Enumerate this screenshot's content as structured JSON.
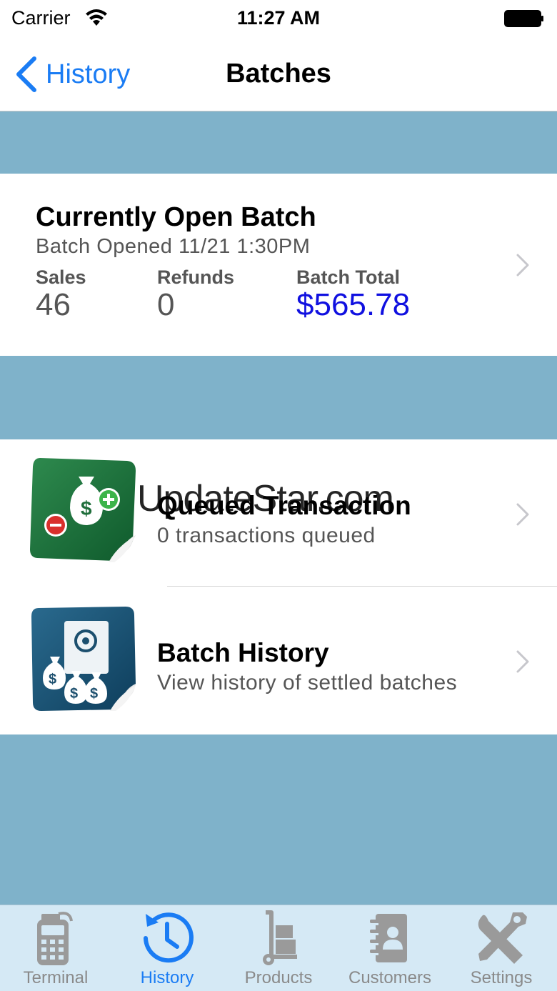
{
  "status_bar": {
    "carrier": "Carrier",
    "time": "11:27 AM"
  },
  "nav": {
    "back_label": "History",
    "title": "Batches"
  },
  "open_batch": {
    "title": "Currently Open Batch",
    "opened": "Batch Opened 11/21 1:30PM",
    "sales_label": "Sales",
    "sales_value": "46",
    "refunds_label": "Refunds",
    "refunds_value": "0",
    "total_label": "Batch Total",
    "total_value": "$565.78"
  },
  "options": [
    {
      "title": "Queued Transaction",
      "subtitle": "0 transactions queued",
      "icon": "money-bag-plus-minus-icon"
    },
    {
      "title": "Batch History",
      "subtitle": "View history of settled batches",
      "icon": "money-bags-safe-icon"
    }
  ],
  "watermark": "UpdateStar.com",
  "tabs": [
    {
      "label": "Terminal",
      "icon": "terminal-icon",
      "active": false
    },
    {
      "label": "History",
      "icon": "clock-icon",
      "active": true
    },
    {
      "label": "Products",
      "icon": "hand-truck-icon",
      "active": false
    },
    {
      "label": "Customers",
      "icon": "address-book-icon",
      "active": false
    },
    {
      "label": "Settings",
      "icon": "tools-icon",
      "active": false
    }
  ],
  "colors": {
    "accent": "#1a7cf4",
    "background": "#7fb2ca",
    "total_value": "#1010e0",
    "tab_bar": "#d5e9f5",
    "inactive_tab": "#8a8a8a"
  }
}
